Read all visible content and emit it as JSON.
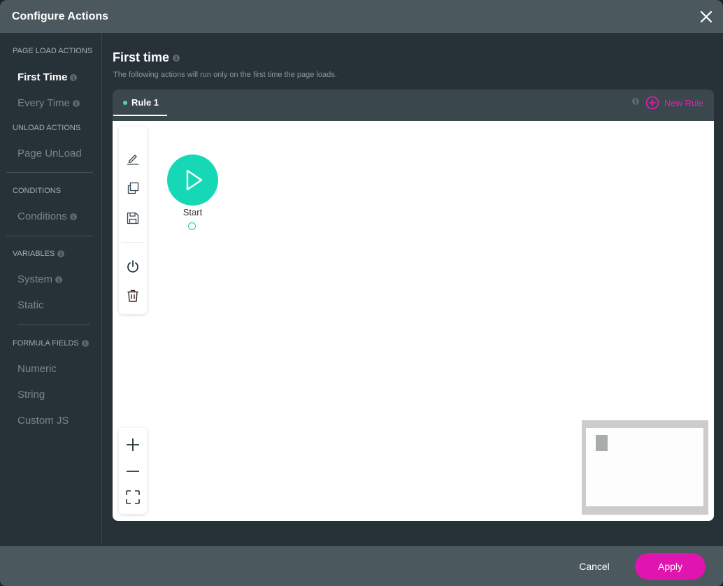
{
  "header": {
    "title": "Configure Actions",
    "close_icon": "close-icon"
  },
  "sidebar": {
    "sections": [
      {
        "label": "PAGE LOAD ACTIONS",
        "info": false
      },
      {
        "label": "UNLOAD ACTIONS",
        "info": false
      },
      {
        "label": "CONDITIONS",
        "info": false
      },
      {
        "label": "VARIABLES",
        "info": true
      },
      {
        "label": "FORMULA FIELDS",
        "info": true
      }
    ],
    "items": [
      {
        "label": "First Time",
        "active": true,
        "info": true
      },
      {
        "label": "Every Time",
        "active": false,
        "info": true
      },
      {
        "label": "Page UnLoad",
        "active": false,
        "info": false
      },
      {
        "label": "Conditions",
        "active": false,
        "info": true
      },
      {
        "label": "System",
        "active": false,
        "info": true
      },
      {
        "label": "Static",
        "active": false,
        "info": false
      },
      {
        "label": "Numeric",
        "active": false,
        "info": false
      },
      {
        "label": "String",
        "active": false,
        "info": false
      },
      {
        "label": "Custom JS",
        "active": false,
        "info": false
      }
    ]
  },
  "main": {
    "title": "First time",
    "subtitle": "The following actions will run only on the first time the page loads.",
    "tabs": [
      {
        "label": "Rule 1",
        "active": true,
        "status_color": "#5ad1a0"
      }
    ],
    "new_rule_label": "New Rule",
    "toolbar": {
      "buttons": [
        "edit-icon",
        "duplicate-icon",
        "save-icon",
        "power-icon",
        "trash-icon"
      ]
    },
    "zoom_controls": [
      "zoom-in-icon",
      "zoom-out-icon",
      "fit-screen-icon"
    ],
    "start_node": {
      "label": "Start"
    }
  },
  "footer": {
    "cancel_label": "Cancel",
    "apply_label": "Apply"
  },
  "colors": {
    "accent": "#e014ae",
    "start_node": "#16d8b6",
    "header_bg": "#4b595f",
    "body_bg": "#263238"
  }
}
